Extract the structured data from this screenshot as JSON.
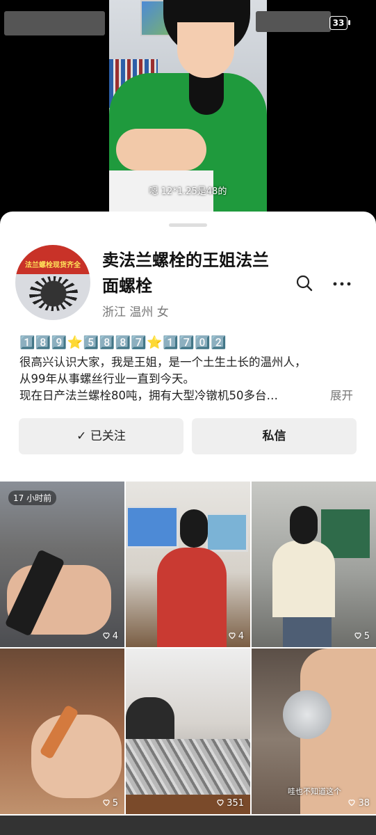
{
  "video": {
    "caption": "嗯 12*1.25是48的",
    "battery": "33"
  },
  "profile": {
    "avatar_text": "法兰螺栓现货齐全",
    "name": "卖法兰螺栓的王姐法兰面螺栓",
    "location": "浙江 温州 女",
    "phone_line": "1️⃣8️⃣9️⃣⭐5️⃣8️⃣8️⃣7️⃣⭐1️⃣7️⃣0️⃣2️⃣",
    "bio_line1": "很高兴认识大家，我是王姐，是一个土生土长的温州人，",
    "bio_line2": "从99年从事螺丝行业一直到今天。",
    "bio_line3": "现在日产法兰螺栓80吨，拥有大型冷镦机50多台…",
    "expand_label": "展开",
    "follow_label": "✓ 已关注",
    "message_label": "私信"
  },
  "posts": [
    {
      "likes": "4",
      "badge": "17 小时前"
    },
    {
      "likes": "4"
    },
    {
      "likes": "5"
    },
    {
      "likes": "5"
    },
    {
      "likes": "351"
    },
    {
      "likes": "38",
      "overlay": "哇也不知道这个"
    }
  ]
}
